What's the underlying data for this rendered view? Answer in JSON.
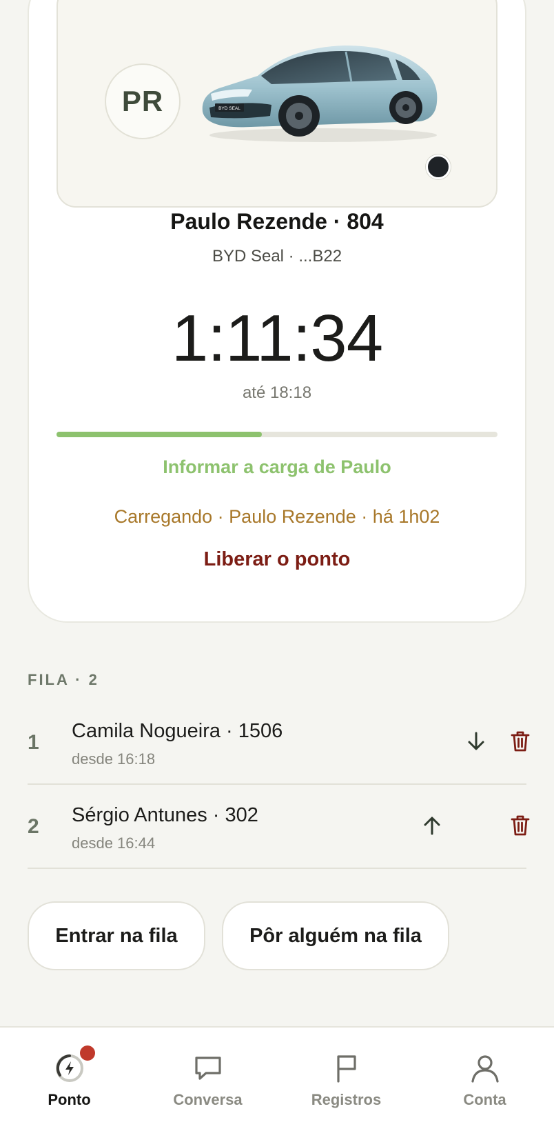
{
  "session": {
    "avatar_initials": "PR",
    "driver_line": "Paulo Rezende · 804",
    "car_line": "BYD Seal · ...B22",
    "plate_badge": "BYD SEAL",
    "timer": "1:11:34",
    "until": "até 18:18",
    "progress_fraction": 0.465,
    "report_link": "Informar a carga de Paulo",
    "status": "Carregando · Paulo Rezende · há 1h02",
    "release_link": "Liberar o ponto"
  },
  "queue": {
    "title": "FILA · 2",
    "items": [
      {
        "position": "1",
        "name": "Camila Nogueira · 1506",
        "since": "desde 16:18",
        "move": "down"
      },
      {
        "position": "2",
        "name": "Sérgio Antunes · 302",
        "since": "desde 16:44",
        "move": "up"
      }
    ]
  },
  "actions": {
    "join": "Entrar na fila",
    "add_someone": "Pôr alguém na fila"
  },
  "nav": {
    "items": [
      {
        "label": "Ponto",
        "icon": "charger-icon",
        "active": true,
        "badge": true
      },
      {
        "label": "Conversa",
        "icon": "chat-icon",
        "active": false
      },
      {
        "label": "Registros",
        "icon": "flag-icon",
        "active": false
      },
      {
        "label": "Conta",
        "icon": "user-icon",
        "active": false
      }
    ]
  },
  "colors": {
    "accent_green": "#8dc26e",
    "status_amber": "#a8782a",
    "danger_red": "#7c1d14",
    "notification_red": "#c0392b",
    "background": "#f5f5f1"
  }
}
